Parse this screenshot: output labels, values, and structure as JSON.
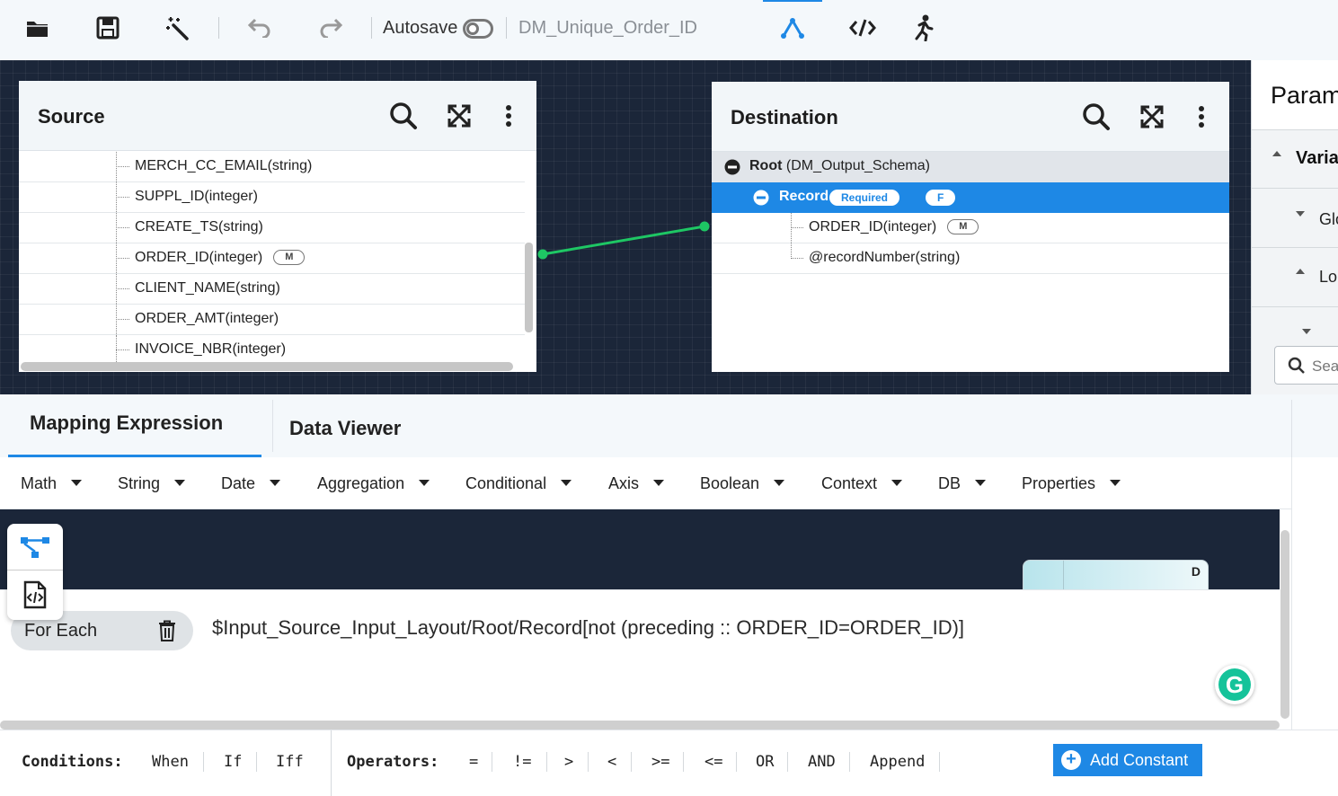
{
  "toolbar": {
    "autosave_label": "Autosave",
    "document_name": "DM_Unique_Order_ID"
  },
  "source": {
    "title": "Source",
    "rows": [
      {
        "label": "MERCH_CC_EMAIL(string)",
        "badge": ""
      },
      {
        "label": "SUPPL_ID(integer)",
        "badge": ""
      },
      {
        "label": "CREATE_TS(string)",
        "badge": ""
      },
      {
        "label": "ORDER_ID(integer)",
        "badge": "M"
      },
      {
        "label": "CLIENT_NAME(string)",
        "badge": ""
      },
      {
        "label": "ORDER_AMT(integer)",
        "badge": ""
      },
      {
        "label": "INVOICE_NBR(integer)",
        "badge": ""
      }
    ]
  },
  "destination": {
    "title": "Destination",
    "root_label": "Root",
    "root_schema": "(DM_Output_Schema)",
    "record_label": "Record",
    "record_required": "Required",
    "record_f": "F",
    "child1_label": "ORDER_ID(integer)",
    "child1_badge": "M",
    "child2_label": "@recordNumber(string)"
  },
  "params": {
    "title": "Param",
    "items": [
      "Varia",
      "Glo",
      "Lo"
    ],
    "search_placeholder": "Sea"
  },
  "tabs": {
    "mapping_expression": "Mapping Expression",
    "data_viewer": "Data Viewer"
  },
  "functions": [
    "Math",
    "String",
    "Date",
    "Aggregation",
    "Conditional",
    "Axis",
    "Boolean",
    "Context",
    "DB",
    "Properties"
  ],
  "editor": {
    "node_label": "D",
    "foreach_label": "For Each",
    "expression": "$Input_Source_Input_Layout/Root/Record[not (preceding :: ORDER_ID=ORDER_ID)]"
  },
  "bottom": {
    "conditions_label": "Conditions:",
    "conditions": [
      "When",
      "If",
      "Iff"
    ],
    "operators_label": "Operators:",
    "operators": [
      "=",
      "!=",
      ">",
      "<",
      ">=",
      "<=",
      "OR",
      "AND",
      "Append"
    ],
    "add_constant_label": "Add Constant"
  },
  "colors": {
    "accent": "#1e88e5",
    "canvas": "#1b2639",
    "link": "#1ec764"
  }
}
